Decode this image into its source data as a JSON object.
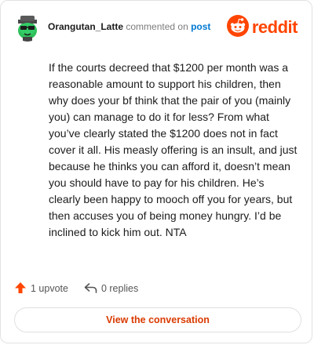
{
  "header": {
    "username": "Orangutan_Latte",
    "action_text": "commented on",
    "post_link": "post",
    "brand": "reddit"
  },
  "comment": {
    "body": "If the courts decreed that $1200 per month was a reasonable amount to support his children, then why does your bf think that the pair of you (mainly you) can manage to do it for less? From what you’ve clearly stated the $1200 does not in fact cover it all. His measly offering is an insult, and just because he thinks you can afford it, doesn’t mean you should have to pay for his children. He’s clearly been happy to mooch off you for years, but then accuses you of being money hungry. I’d be inclined to kick him out. NTA"
  },
  "footer": {
    "upvotes": "1 upvote",
    "replies": "0 replies",
    "view_button": "View the conversation"
  },
  "icons": {
    "avatar": "snoo-avatar-icon",
    "logo": "reddit-logo-icon",
    "upvote": "upvote-arrow-icon",
    "reply": "reply-arrow-icon"
  },
  "colors": {
    "brand": "#ff4500",
    "link": "#0079d3",
    "button_text": "#d93a00"
  }
}
